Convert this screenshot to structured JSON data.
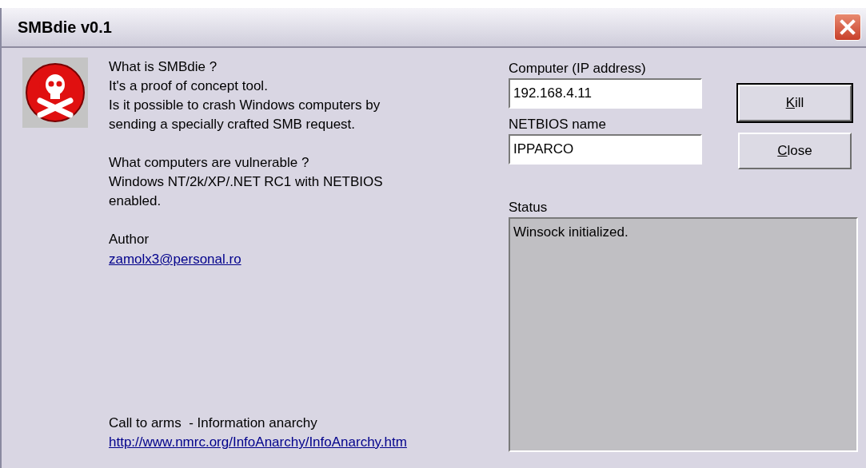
{
  "window": {
    "title": "SMBdie v0.1"
  },
  "info": {
    "sections": [
      {
        "lines": [
          "What is SMBdie ?",
          "It's a proof of concept tool.",
          "Is it possible to crash Windows computers by",
          "sending a specially crafted SMB request."
        ]
      },
      {
        "lines": [
          "What computers are vulnerable ?",
          "Windows NT/2k/XP/.NET RC1 with NETBIOS",
          "enabled."
        ]
      },
      {
        "lines": [
          "Author"
        ],
        "link": "zamolx3@personal.ro"
      }
    ],
    "footer": {
      "text": "Call to arms  - Information anarchy",
      "link": "http://www.nmrc.org/InfoAnarchy/InfoAnarchy.htm"
    }
  },
  "fields": [
    {
      "label": "Computer (IP address)",
      "value": "192.168.4.11"
    },
    {
      "label": "NETBIOS name",
      "value": "IPPARCO"
    }
  ],
  "buttons": [
    {
      "label": "Kill",
      "first_letter_underlined": true,
      "default": true
    },
    {
      "label": "Close",
      "first_letter_underlined": true,
      "default": false
    }
  ],
  "status": {
    "label": "Status",
    "text": "Winsock initialized."
  }
}
